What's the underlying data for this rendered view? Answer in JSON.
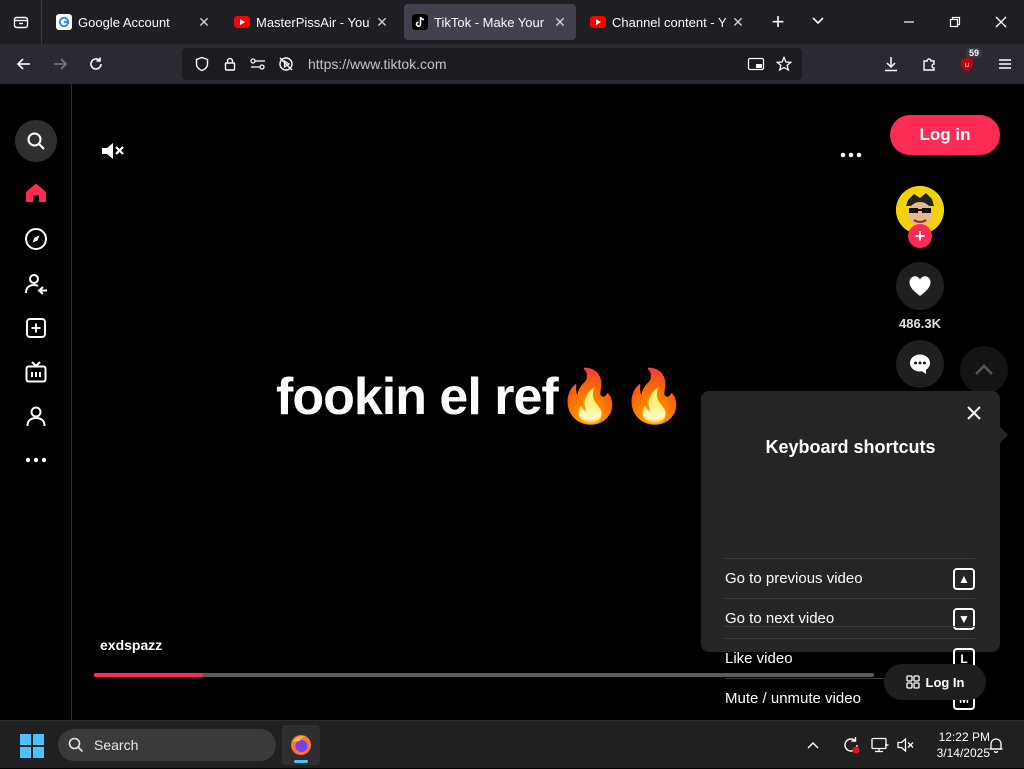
{
  "browser": {
    "tabs": [
      {
        "title": "Google Account",
        "favicon": "google-icon",
        "active": false
      },
      {
        "title": "MasterPissAir - YouTube",
        "favicon": "youtube-icon",
        "active": false
      },
      {
        "title": "TikTok - Make Your Day",
        "favicon": "tiktok-icon",
        "active": true
      },
      {
        "title": "Channel content - YouTube",
        "favicon": "youtube-icon",
        "active": false
      }
    ],
    "url": "https://www.tiktok.com",
    "extension_badge": "59"
  },
  "tiktok": {
    "login_label": "Log in",
    "video_text": "fookin el ref🔥🔥",
    "author": "exdspazz",
    "like_count": "486.3K",
    "progress": 0.14,
    "bottom_login_label": "Log In",
    "shortcuts": {
      "title": "Keyboard shortcuts",
      "items": [
        {
          "label": "Go to previous video",
          "key": "▲"
        },
        {
          "label": "Go to next video",
          "key": "▼"
        },
        {
          "label": "Like video",
          "key": "L"
        },
        {
          "label": "Mute / unmute video",
          "key": "M"
        }
      ]
    }
  },
  "taskbar": {
    "search_placeholder": "Search",
    "time": "12:22 PM",
    "date": "3/14/2025"
  },
  "colors": {
    "accent": "#fe2c55",
    "chrome_bg": "#1f1e25",
    "navbar_bg": "#2b2a33",
    "windows_accent": "#4cc2ff"
  }
}
